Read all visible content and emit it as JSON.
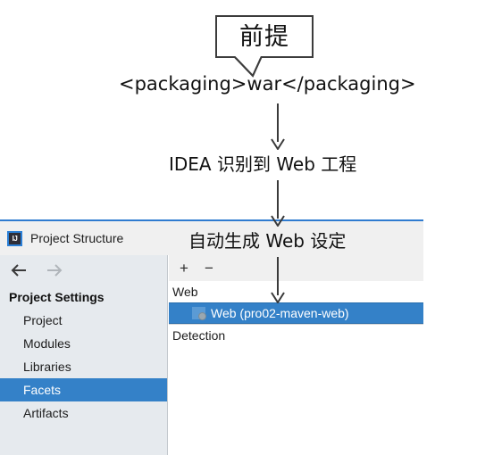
{
  "diagram": {
    "callout": {
      "text": "前提",
      "icon": "speech-bubble"
    },
    "steps": [
      {
        "text": "<packaging>war</packaging>"
      },
      {
        "text": "IDEA 识别到 Web 工程"
      },
      {
        "text": "自动生成 Web 设定"
      }
    ],
    "arrow_icon": "arrow-down-icon",
    "colors": {
      "outline": "#3c3c3c",
      "text": "#111111"
    }
  },
  "dialog": {
    "title": "Project Structure",
    "app_icon": "intellij-idea-icon",
    "app_icon_letters": "IJ",
    "nav": {
      "back_icon": "arrow-left-icon",
      "back_glyph": "←",
      "forward_icon": "arrow-right-icon",
      "forward_glyph": "→"
    },
    "sidebar": {
      "header": "Project Settings",
      "items": [
        {
          "label": "Project",
          "selected": false
        },
        {
          "label": "Modules",
          "selected": false
        },
        {
          "label": "Libraries",
          "selected": false
        },
        {
          "label": "Facets",
          "selected": true
        },
        {
          "label": "Artifacts",
          "selected": false
        }
      ]
    },
    "panel": {
      "toolbar": {
        "add_label": "+",
        "add_icon": "plus-icon",
        "remove_label": "−",
        "remove_icon": "minus-icon"
      },
      "tree": [
        {
          "label": "Web",
          "type": "group",
          "selected": false
        },
        {
          "label": "Web (pro02-maven-web)",
          "type": "facet",
          "icon": "web-facet-icon",
          "selected": true
        },
        {
          "label": "Detection",
          "type": "group",
          "selected": false
        }
      ]
    },
    "colors": {
      "accent": "#2f7bd0",
      "selection": "#3481c8",
      "sidebar_bg": "#e6eaee",
      "toolbar_bg": "#f0f0f0"
    }
  }
}
